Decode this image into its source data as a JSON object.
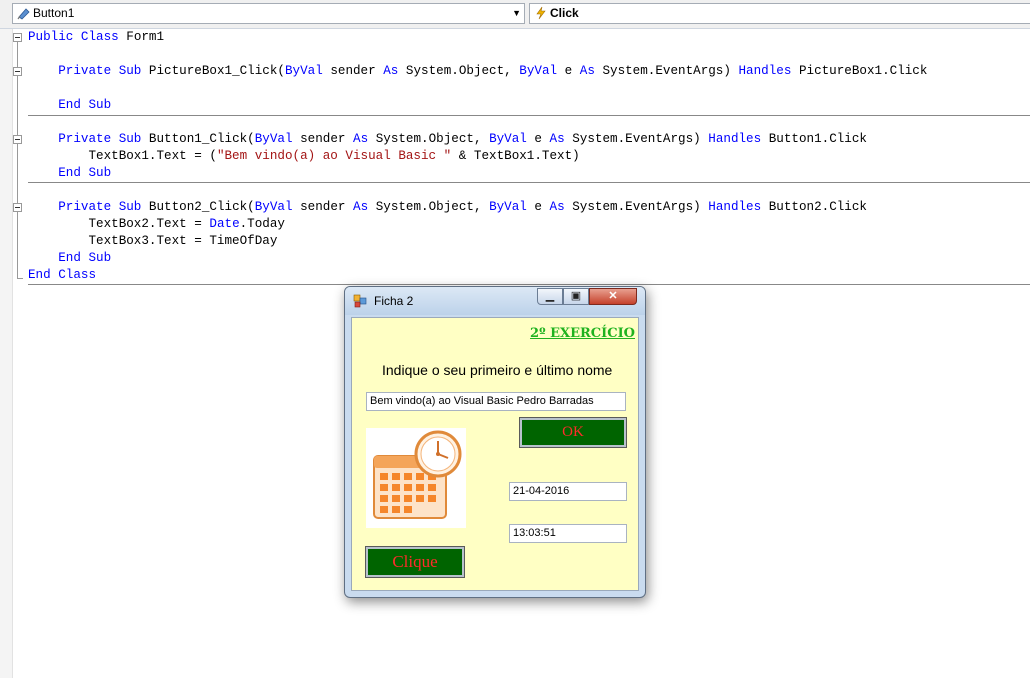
{
  "toolbar": {
    "object_combo": "Button1",
    "event_combo": "Click"
  },
  "code": {
    "l1_a": "Public Class",
    "l1_b": " Form1",
    "s1_a": "    Private Sub",
    "s1_b": " PictureBox1_Click(",
    "s1_c": "ByVal",
    "s1_d": " sender ",
    "s1_e": "As",
    "s1_f": " System.Object, ",
    "s1_g": "ByVal",
    "s1_h": " e ",
    "s1_i": "As",
    "s1_j": " System.EventArgs) ",
    "s1_k": "Handles",
    "s1_l": " PictureBox1.Click",
    "end_sub": "    End Sub",
    "s2_a": "    Private Sub",
    "s2_b": " Button1_Click(",
    "s2_l": " Button1.Click",
    "s2_body_a": "        TextBox1.Text = (",
    "s2_body_str": "\"Bem vindo(a) ao Visual Basic \"",
    "s2_body_c": " & TextBox1.Text)",
    "s3_a": "    Private Sub",
    "s3_b": " Button2_Click(",
    "s3_l": " Button2.Click",
    "s3_body1_a": "        TextBox2.Text = ",
    "s3_body1_kw": "Date",
    "s3_body1_c": ".Today",
    "s3_body2": "        TextBox3.Text = TimeOfDay",
    "end_class": "End Class"
  },
  "form": {
    "title": "Ficha 2",
    "heading": "2º EXERCÍCIO",
    "prompt": "Indique o seu primeiro e último nome",
    "textbox1": "Bem vindo(a) ao Visual Basic Pedro Barradas",
    "ok_label": "OK",
    "textbox2": "21-04-2016",
    "textbox3": "13:03:51",
    "clique_label": "Clique"
  },
  "colors": {
    "keyword": "#0000ff",
    "string": "#a31515",
    "form_bg": "#ffffc4",
    "button_bg": "#006400",
    "button_text": "#ff2b2b",
    "heading": "#1fb21f"
  }
}
